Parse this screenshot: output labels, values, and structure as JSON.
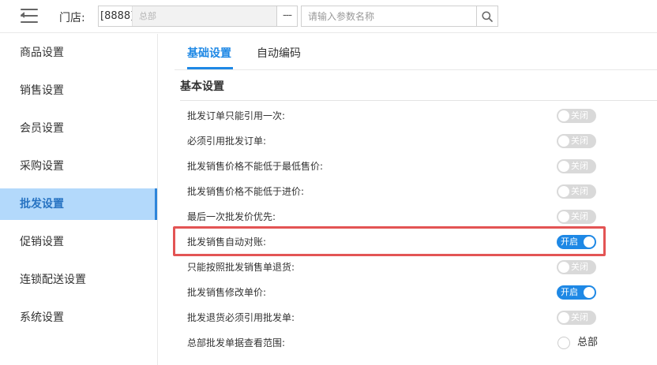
{
  "header": {
    "store_label": "门店:",
    "store_code": "[8888]",
    "store_name": "总部",
    "store_more": "---",
    "search_placeholder": "请输入参数名称"
  },
  "sidebar": {
    "items": [
      {
        "label": "商品设置"
      },
      {
        "label": "销售设置"
      },
      {
        "label": "会员设置"
      },
      {
        "label": "采购设置"
      },
      {
        "label": "批发设置",
        "active": true
      },
      {
        "label": "促销设置"
      },
      {
        "label": "连锁配送设置"
      },
      {
        "label": "系统设置"
      }
    ]
  },
  "tabs": [
    {
      "label": "基础设置",
      "active": true
    },
    {
      "label": "自动编码"
    }
  ],
  "section": {
    "title": "基本设置"
  },
  "switch_text": {
    "on": "开启",
    "off": "关闭"
  },
  "settings": [
    {
      "label": "批发订单只能引用一次:",
      "value": "off"
    },
    {
      "label": "必须引用批发订单:",
      "value": "off"
    },
    {
      "label": "批发销售价格不能低于最低售价:",
      "value": "off"
    },
    {
      "label": "批发销售价格不能低于进价:",
      "value": "off"
    },
    {
      "label": "最后一次批发价优先:",
      "value": "off"
    },
    {
      "label": "批发销售自动对账:",
      "value": "on"
    },
    {
      "label": "只能按照批发销售单退货:",
      "value": "off"
    },
    {
      "label": "批发销售修改单价:",
      "value": "on"
    },
    {
      "label": "批发退货必须引用批发单:",
      "value": "off"
    },
    {
      "label": "总部批发单据查看范围:",
      "value": "radio",
      "option": "总部"
    }
  ],
  "colors": {
    "accent": "#1e88e5",
    "active_bg": "#b3d9fb",
    "highlight_border": "#e35454",
    "switch_off": "#d9d9d9"
  },
  "icons": {
    "menu": "menu-toggle-icon",
    "search": "search-icon"
  }
}
